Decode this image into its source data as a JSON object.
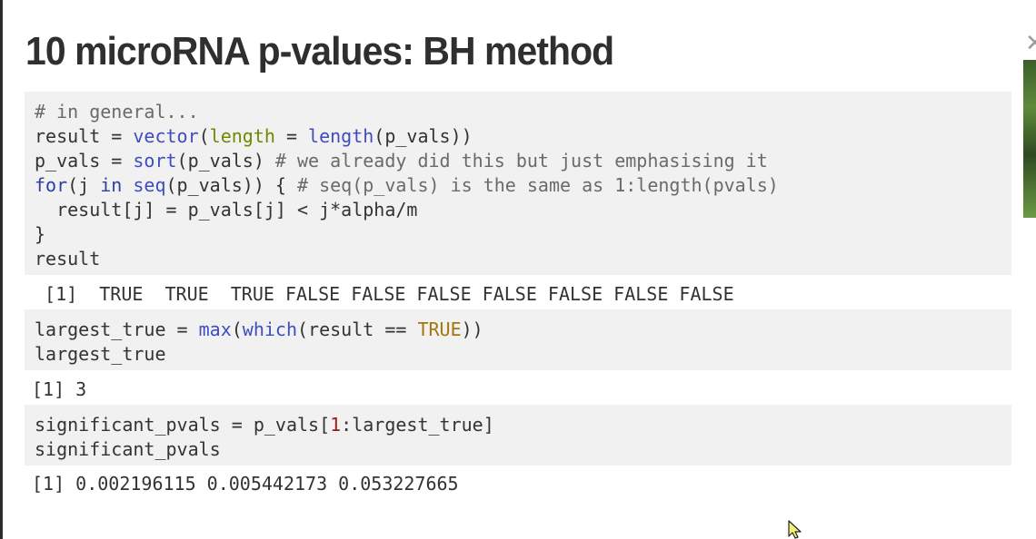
{
  "slide": {
    "title": "10 microRNA p-values: BH method"
  },
  "blocks": {
    "block1": {
      "l1": "# in general...",
      "l2": {
        "a": "result = ",
        "fn": "vector",
        "b": "(",
        "arg": "length",
        "c": " = ",
        "fn2": "length",
        "d": "(p_vals))"
      },
      "l3": {
        "a": "p_vals = ",
        "fn": "sort",
        "b": "(p_vals) ",
        "comment": "# we already did this but just emphasising it"
      },
      "l4": {
        "kw": "for",
        "a": "(j ",
        "kw2": "in",
        "b": " ",
        "fn": "seq",
        "c": "(p_vals)) { ",
        "comment": "# seq(p_vals) is the same as 1:length(pvals)"
      },
      "l5": "  result[j] = p_vals[j] < j*alpha/m",
      "l6": "}",
      "l7": "result"
    },
    "output1": " [1]  TRUE  TRUE  TRUE FALSE FALSE FALSE FALSE FALSE FALSE FALSE",
    "block2": {
      "l1": {
        "a": "largest_true = ",
        "fn": "max",
        "b": "(",
        "fn2": "which",
        "c": "(result == ",
        "lit": "TRUE",
        "d": "))"
      },
      "l2": "largest_true"
    },
    "output2": "[1] 3",
    "block3": {
      "l1": {
        "a": "significant_pvals = p_vals[",
        "num": "1",
        "b": ":largest_true]"
      },
      "l2": "significant_pvals"
    },
    "output3": "[1] 0.002196115 0.005442173 0.053227665"
  },
  "icons": {
    "close": "close-icon",
    "cursor": "mouse-pointer-icon",
    "thumbnail": "video-thumbnail"
  },
  "colors": {
    "code_bg": "#f1f1f1",
    "title": "#2f2f2f",
    "keyword": "#2d3fa0",
    "argument": "#6d8a00",
    "literal": "#a3770a",
    "number": "#9b1c1c",
    "cursor": "#f0f07a"
  }
}
